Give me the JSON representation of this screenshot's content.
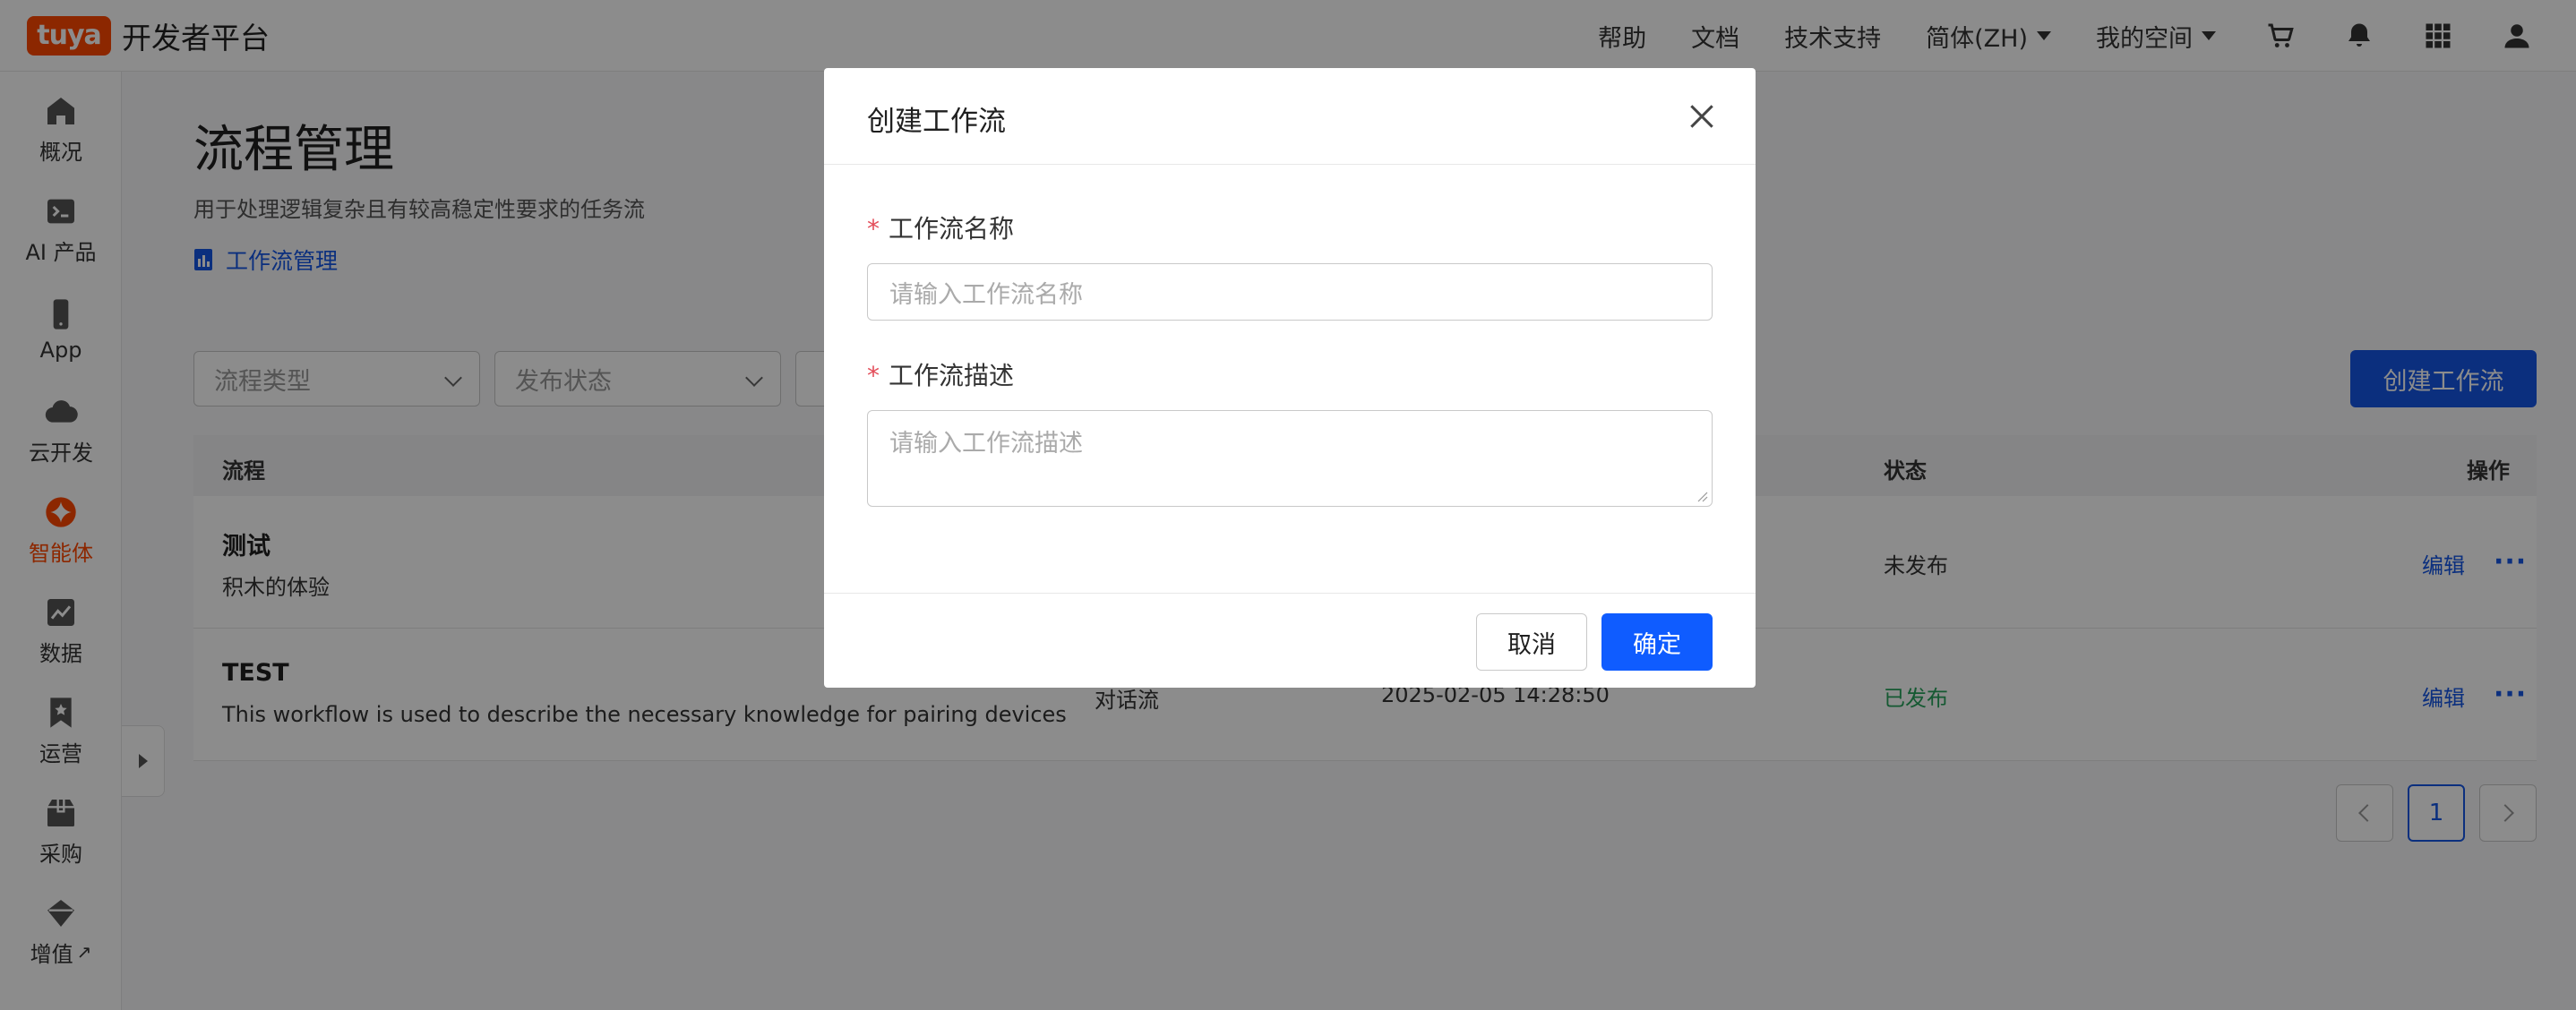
{
  "brand": {
    "logo_text": "tuya",
    "name": "开发者平台",
    "accent": "#ff4800"
  },
  "top_nav": {
    "help": "帮助",
    "docs": "文档",
    "support": "技术支持",
    "language": "简体(ZH)",
    "workspace": "我的空间",
    "icons": [
      "cart-icon",
      "bell-icon",
      "apps-grid-icon",
      "user-icon"
    ]
  },
  "sidebar": {
    "items": [
      {
        "label": "概况",
        "icon": "home-icon"
      },
      {
        "label": "AI 产品",
        "icon": "terminal-icon"
      },
      {
        "label": "App",
        "icon": "phone-icon"
      },
      {
        "label": "云开发",
        "icon": "cloud-icon"
      },
      {
        "label": "智能体",
        "icon": "agent-star-icon",
        "active": true
      },
      {
        "label": "数据",
        "icon": "chart-icon"
      },
      {
        "label": "运营",
        "icon": "bookmark-icon"
      },
      {
        "label": "采购",
        "icon": "box-icon"
      },
      {
        "label": "增值",
        "icon": "diamond-icon",
        "external": "↗"
      }
    ]
  },
  "page": {
    "title": "流程管理",
    "description": "用于处理逻辑复杂且有较高稳定性要求的任务流",
    "doc_link": "工作流管理",
    "filters": {
      "type_placeholder": "流程类型",
      "status_placeholder": "发布状态"
    },
    "create_button": "创建工作流",
    "table": {
      "headers": {
        "flow": "流程",
        "status": "状态",
        "actions": "操作"
      },
      "rows": [
        {
          "name": "测试",
          "desc": "积木的体验",
          "type": "",
          "time": "",
          "status": "未发布",
          "published": false,
          "edit": "编辑",
          "more": "···"
        },
        {
          "name": "TEST",
          "desc": "This workflow is used to describe the necessary knowledge for pairing devices",
          "type": "对话流",
          "time": "2025-02-05 14:28:50",
          "status": "已发布",
          "published": true,
          "edit": "编辑",
          "more": "···"
        }
      ]
    },
    "pagination": {
      "current": "1"
    }
  },
  "modal": {
    "title": "创建工作流",
    "required_mark": "*",
    "name_label": "工作流名称",
    "name_placeholder": "请输入工作流名称",
    "desc_label": "工作流描述",
    "desc_placeholder": "请输入工作流描述",
    "cancel": "取消",
    "confirm": "确定"
  }
}
